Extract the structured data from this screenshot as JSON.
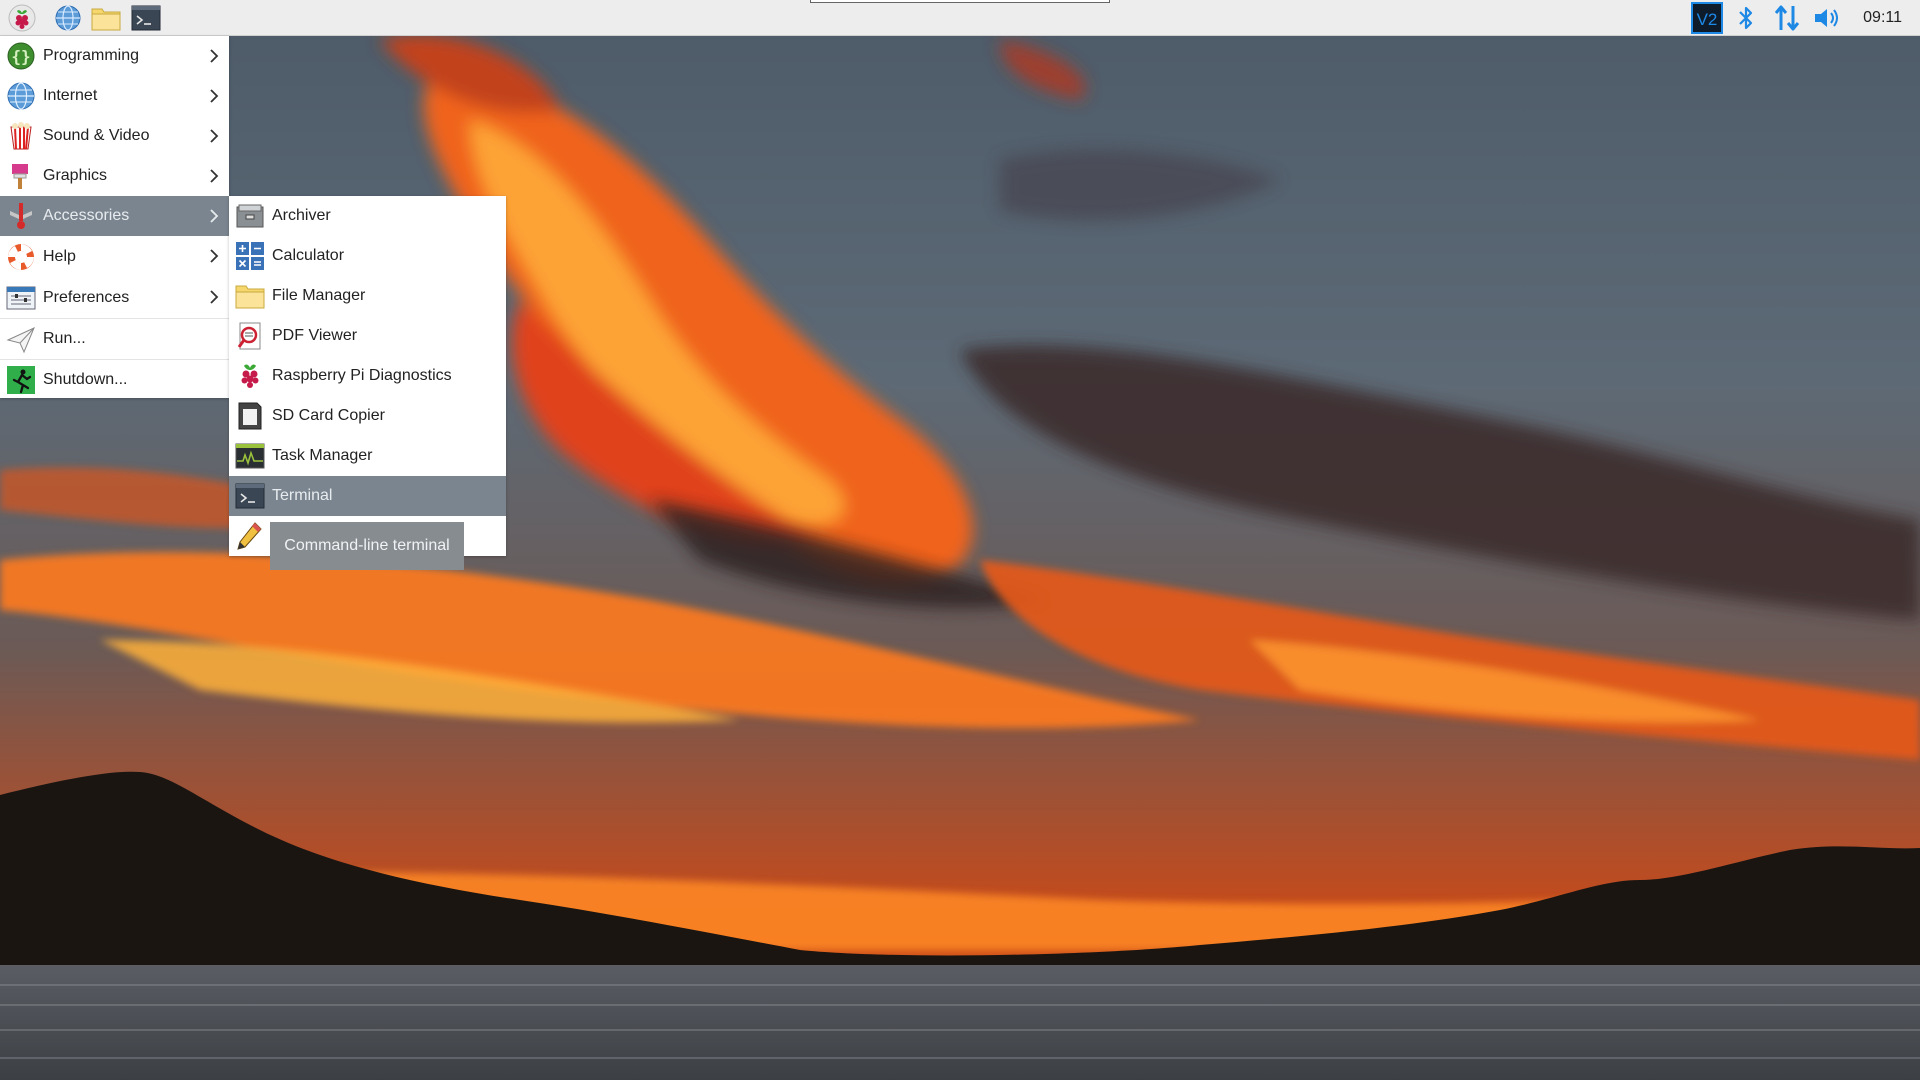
{
  "panel": {
    "launchers": [
      {
        "icon": "raspberry-pi-menu-icon"
      },
      {
        "icon": "web-browser-icon"
      },
      {
        "icon": "file-manager-icon"
      },
      {
        "icon": "terminal-icon"
      }
    ],
    "tray": [
      {
        "icon": "vnc-icon"
      },
      {
        "icon": "bluetooth-icon"
      },
      {
        "icon": "network-icon"
      },
      {
        "icon": "volume-icon"
      }
    ],
    "clock": "09:11",
    "accent_color": "#1e88e5"
  },
  "main_menu": {
    "items": [
      {
        "label": "Programming",
        "icon": "programming-icon",
        "submenu": true
      },
      {
        "label": "Internet",
        "icon": "internet-icon",
        "submenu": true
      },
      {
        "label": "Sound & Video",
        "icon": "sound-video-icon",
        "submenu": true
      },
      {
        "label": "Graphics",
        "icon": "graphics-icon",
        "submenu": true
      },
      {
        "label": "Accessories",
        "icon": "accessories-icon",
        "submenu": true,
        "selected": true
      },
      {
        "label": "Help",
        "icon": "help-icon",
        "submenu": true
      },
      {
        "label": "Preferences",
        "icon": "preferences-icon",
        "submenu": true
      },
      {
        "label": "Run...",
        "icon": "run-icon",
        "submenu": false
      },
      {
        "label": "Shutdown...",
        "icon": "shutdown-icon",
        "submenu": false
      }
    ],
    "selected_color": "#7a858f"
  },
  "accessories_menu": {
    "items": [
      {
        "label": "Archiver",
        "icon": "archiver-icon"
      },
      {
        "label": "Calculator",
        "icon": "calculator-icon"
      },
      {
        "label": "File Manager",
        "icon": "folder-icon"
      },
      {
        "label": "PDF Viewer",
        "icon": "pdf-viewer-icon"
      },
      {
        "label": "Raspberry Pi Diagnostics",
        "icon": "raspberry-diagnostics-icon"
      },
      {
        "label": "SD Card Copier",
        "icon": "sd-card-icon"
      },
      {
        "label": "Task Manager",
        "icon": "task-manager-icon"
      },
      {
        "label": "Terminal",
        "icon": "terminal-icon",
        "selected": true
      },
      {
        "label": "",
        "icon": "text-editor-icon"
      }
    ]
  },
  "tooltip": {
    "text": "Command-line terminal"
  }
}
